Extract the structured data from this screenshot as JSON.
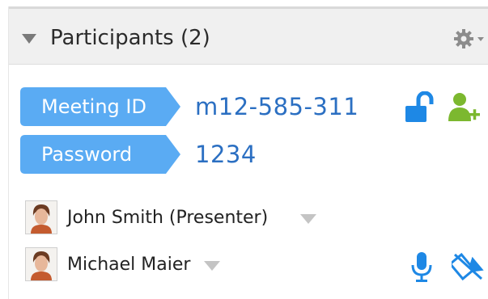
{
  "panel": {
    "title": "Participants (2)",
    "icons": {
      "collapse": "collapse-arrow-icon",
      "settings": "gear-icon"
    }
  },
  "meeting": {
    "id_label": "Meeting ID",
    "id_value": "m12-585-311",
    "password_label": "Password",
    "password_value": "1234"
  },
  "participants": [
    {
      "name": "John Smith (Presenter)"
    },
    {
      "name": "Michael Maier"
    }
  ],
  "colors": {
    "accent_blue": "#5aabf3",
    "value_blue": "#2b6fc2",
    "icon_blue": "#1e88e5",
    "invite_green": "#7cb82f"
  }
}
